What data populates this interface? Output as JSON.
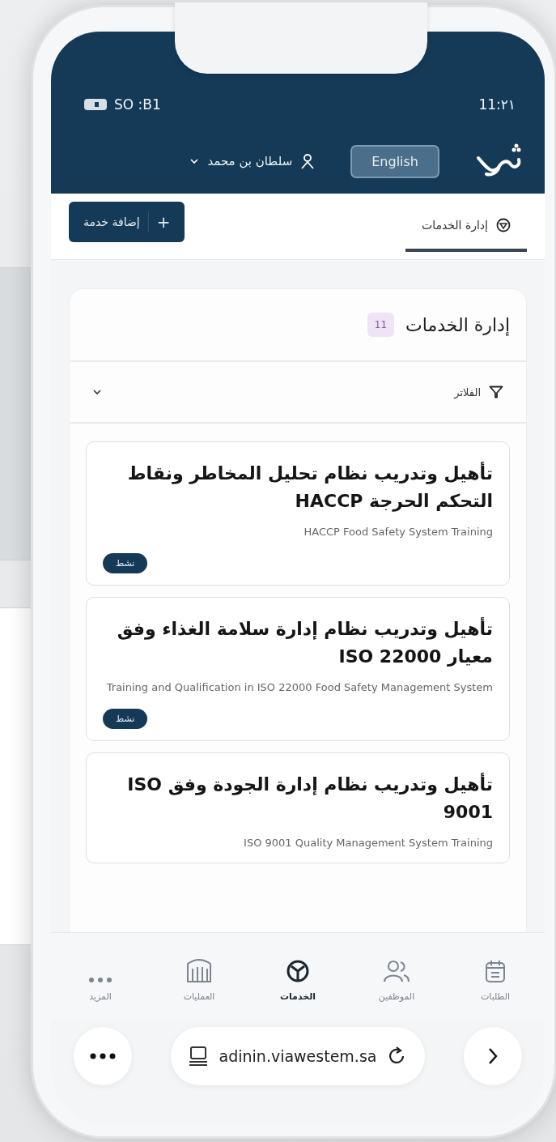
{
  "status_bar": {
    "carrier": "SO :B1",
    "time": "11:٢١"
  },
  "header": {
    "user_name": "سلطان بن محمد",
    "language_button": "English"
  },
  "tabs": [
    {
      "label": "إدارة الخدمات",
      "selected": true
    }
  ],
  "add_button": {
    "icon": "+",
    "label": "إضافة خدمة"
  },
  "section": {
    "title": "إدارة الخدمات",
    "count": "11",
    "filter_label": "الفلاتر",
    "filters_expanded": false
  },
  "services": [
    {
      "title": "تأهيل وتدريب نظام تحليل المخاطر ونقاط التحكم الحرجة HACCP",
      "subtitle": "HACCP Food Safety System Training",
      "status": "نشط"
    },
    {
      "title": "تأهيل وتدريب نظام إدارة سلامة الغذاء وفق معيار ISO 22000",
      "subtitle": "Training and Qualification in ISO 22000 Food Safety Management System",
      "status": "نشط"
    },
    {
      "title": "تأهيل وتدريب نظام إدارة الجودة وفق ISO 9001",
      "subtitle": "ISO 9001 Quality Management System Training"
    }
  ],
  "bottom_nav": [
    {
      "kind": "requests",
      "label": "الطلبات",
      "selected": false
    },
    {
      "kind": "employees",
      "label": "الموظفين",
      "selected": false
    },
    {
      "kind": "services",
      "label": "الخدمات",
      "selected": true
    },
    {
      "kind": "operations",
      "label": "العمليات",
      "selected": false
    },
    {
      "kind": "more",
      "label": "المزيد",
      "selected": false
    }
  ],
  "browser": {
    "url": "adinin.viawestem.sa"
  }
}
